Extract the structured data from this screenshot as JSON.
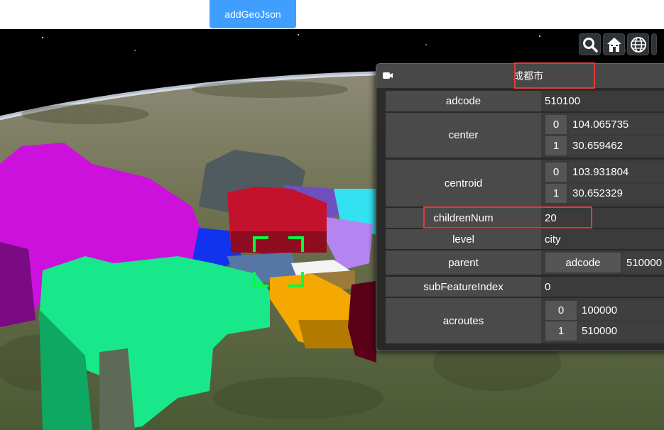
{
  "toolbar": {
    "add_button_label": "addGeoJson"
  },
  "viewer_buttons": {
    "search": "search-icon",
    "home": "home-icon",
    "projection": "globe-icon"
  },
  "infobox": {
    "title": "成都市",
    "rows": {
      "adcode": {
        "key": "adcode",
        "value": "510100"
      },
      "center": {
        "key": "center",
        "items": [
          {
            "index": "0",
            "value": "104.065735"
          },
          {
            "index": "1",
            "value": "30.659462"
          }
        ]
      },
      "centroid": {
        "key": "centroid",
        "items": [
          {
            "index": "0",
            "value": "103.931804"
          },
          {
            "index": "1",
            "value": "30.652329"
          }
        ]
      },
      "childrenNum": {
        "key": "childrenNum",
        "value": "20"
      },
      "level": {
        "key": "level",
        "value": "city"
      },
      "parent": {
        "key": "parent",
        "subkey": "adcode",
        "value": "510000"
      },
      "subFeatureIndex": {
        "key": "subFeatureIndex",
        "value": "0"
      },
      "acroutes": {
        "key": "acroutes",
        "items": [
          {
            "index": "0",
            "value": "100000"
          },
          {
            "index": "1",
            "value": "510000"
          }
        ]
      }
    }
  },
  "colors": {
    "button_blue": "#409eff",
    "highlight_red": "#e53935",
    "reticle_green": "#00ff40"
  }
}
